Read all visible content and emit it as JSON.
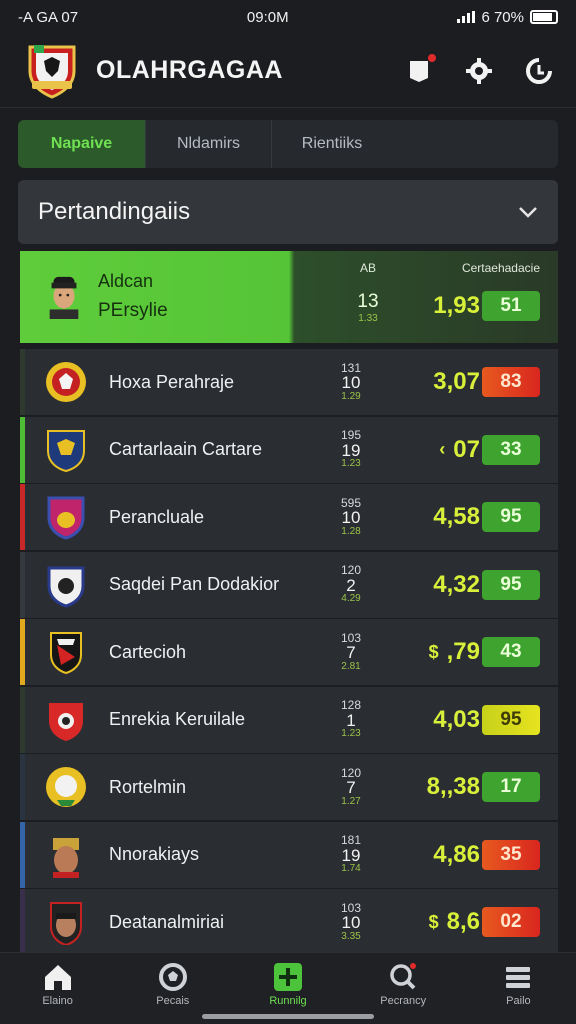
{
  "status": {
    "carrier": "-A GA 07",
    "time": "09:0M",
    "battery": "6 70%"
  },
  "header": {
    "app_title": "OLAHRGAGAA"
  },
  "tabs": [
    {
      "label": "Napaive",
      "active": true
    },
    {
      "label": "Nldamirs",
      "active": false
    },
    {
      "label": "Rientiiks",
      "active": false
    }
  ],
  "section": {
    "title": "Pertandingaiis"
  },
  "featured": {
    "line1": "Aldcan",
    "line2": "PErsylie",
    "col_header_mid": "AB",
    "col_header_right": "Certaehadacie",
    "mid_value": "13",
    "mid_sub": "1.33",
    "odds_value": "1,93",
    "odds_pill": "51",
    "pill_color": "green"
  },
  "matches": [
    {
      "name": "Hoxa Perahraje",
      "top": "131",
      "mid": "10",
      "sub": "1.29",
      "odds": "3,07",
      "pill": "83",
      "pill_color": "red",
      "stripe": "#2f3a2f",
      "emblem": "e1"
    },
    {
      "name": "Cartarlaain Cartare",
      "top": "195",
      "mid": "19",
      "sub": "1.23",
      "odds": "07",
      "odds_prefix": "‹",
      "pill": "33",
      "pill_color": "green",
      "stripe": "#4dbb33",
      "emblem": "e2"
    },
    {
      "name": "Perancluale",
      "top": "595",
      "mid": "10",
      "sub": "1.28",
      "odds": "4,58",
      "pill": "95",
      "pill_color": "green",
      "stripe": "#c9282a",
      "emblem": "e3"
    },
    {
      "name": "Saqdei Pan Dodakior",
      "top": "120",
      "mid": "2",
      "sub": "4.29",
      "odds": "4,32",
      "pill": "95",
      "pill_color": "green",
      "stripe": "#34393f",
      "emblem": "e4"
    },
    {
      "name": "Cartecioh",
      "top": "103",
      "mid": "7",
      "sub": "2.81",
      "odds": ",79",
      "odds_prefix": "$",
      "pill": "43",
      "pill_color": "green",
      "stripe": "#e2a91f",
      "emblem": "e5"
    },
    {
      "name": "Enrekia Keruilale",
      "top": "128",
      "mid": "1",
      "sub": "1.23",
      "odds": "4,03",
      "pill": "95",
      "pill_color": "yellow",
      "stripe": "#2f3a2f",
      "emblem": "e6"
    },
    {
      "name": "Rortelmin",
      "top": "120",
      "mid": "7",
      "sub": "1.27",
      "odds": "8,,38",
      "pill": "17",
      "pill_color": "green",
      "stripe": "#2a3340",
      "emblem": "e7"
    },
    {
      "name": "Nnorakiays",
      "top": "181",
      "mid": "19",
      "sub": "1.74",
      "odds": "4,86",
      "pill": "35",
      "pill_color": "red",
      "stripe": "#3564a8",
      "emblem": "e8"
    },
    {
      "name": "Deatanalmiriai",
      "top": "103",
      "mid": "10",
      "sub": "3.35",
      "odds": "8,6",
      "odds_prefix": "$",
      "pill": "02",
      "pill_color": "red",
      "stripe": "#3a2f4a",
      "emblem": "e9"
    }
  ],
  "bottom_nav": [
    {
      "label": "Elaino",
      "icon": "home-icon",
      "active": false
    },
    {
      "label": "Pecais",
      "icon": "ball-icon",
      "active": false
    },
    {
      "label": "Runnilg",
      "icon": "plus-icon",
      "active": true
    },
    {
      "label": "Pecrancy",
      "icon": "search-icon",
      "active": false
    },
    {
      "label": "Pailo",
      "icon": "menu-icon",
      "active": false
    }
  ],
  "colors": {
    "accent": "#5fcd3b",
    "background": "#1b1d20",
    "row": "#2a2d31"
  }
}
